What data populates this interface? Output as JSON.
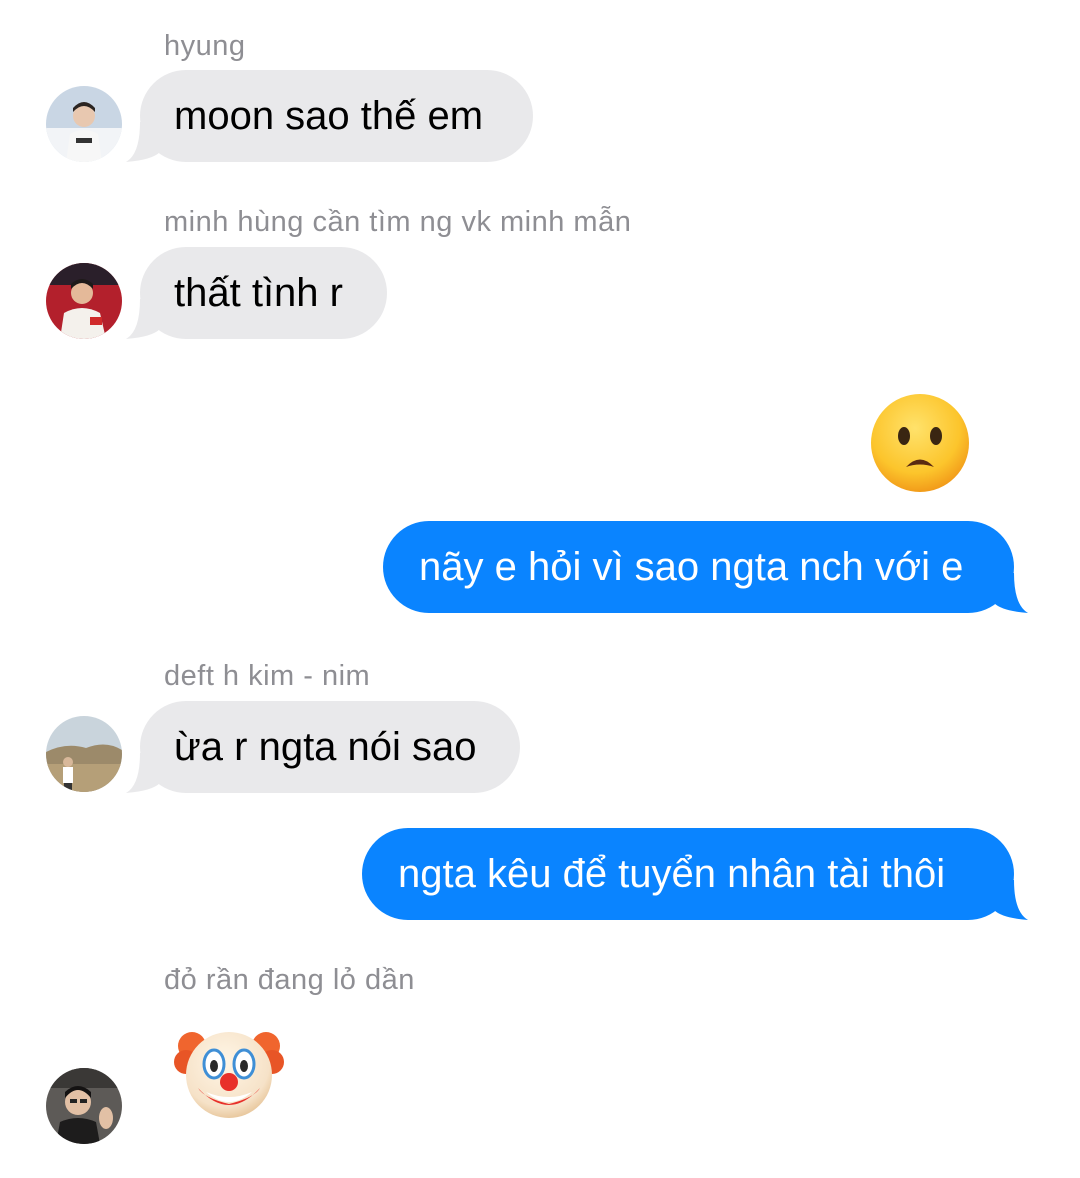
{
  "colors": {
    "incoming_bubble": "#e9e9eb",
    "outgoing_bubble": "#0a84ff",
    "sender_name": "#8e8e93"
  },
  "messages": [
    {
      "sender": "hyung",
      "direction": "incoming",
      "text": "moon sao thế em"
    },
    {
      "sender": "minh hùng cần tìm ng vk minh mẫn",
      "direction": "incoming",
      "text": "thất tình r"
    },
    {
      "direction": "outgoing",
      "emoji": "frowning-face-with-open-mouth"
    },
    {
      "direction": "outgoing",
      "text": "nãy e hỏi vì sao ngta nch với e"
    },
    {
      "sender": "deft h kim - nim",
      "direction": "incoming",
      "text": "ừa r ngta nói sao"
    },
    {
      "direction": "outgoing",
      "text": "ngta kêu để tuyển nhân tài thôi"
    },
    {
      "sender": "đỏ rần đang lỏ dần",
      "direction": "incoming",
      "emoji": "clown-face"
    }
  ]
}
